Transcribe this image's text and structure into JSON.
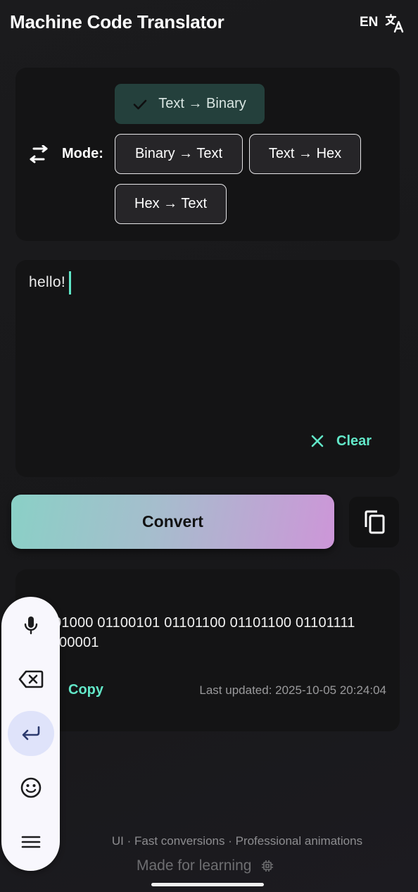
{
  "header": {
    "title": "Machine Code Translator",
    "language_code": "EN",
    "translate_icon": "translate-icon"
  },
  "mode": {
    "label": "Mode:",
    "icon": "swap-horiz-icon",
    "options": [
      {
        "label": "Text → Binary",
        "selected": true
      },
      {
        "label": "Binary → Text",
        "selected": false
      },
      {
        "label": "Text → Hex",
        "selected": false
      },
      {
        "label": "Hex → Text",
        "selected": false
      }
    ]
  },
  "input": {
    "value": "hello!",
    "clear_label": "Clear"
  },
  "actions": {
    "convert_label": "Convert",
    "copy_icon": "content-copy-icon"
  },
  "output": {
    "line1": "01000 01100101 01101100 01101100 01101111",
    "line2": "00001",
    "copy_label": "Copy",
    "last_updated": "Last updated: 2025-10-05 20:24:04"
  },
  "footer": {
    "features": "UI · Fast conversions · Professional animations",
    "made_for": "Made for learning"
  },
  "keyboard_toolbar": {
    "items": [
      "mic-icon",
      "backspace-icon",
      "enter-icon",
      "emoji-icon",
      "menu-icon"
    ]
  },
  "colors": {
    "accent": "#62e7c8",
    "background": "#1a1a1c",
    "card": "#141415",
    "selected_chip": "#24403c",
    "convert_gradient_start": "#8ad0c6",
    "convert_gradient_end": "#cd96d8"
  }
}
